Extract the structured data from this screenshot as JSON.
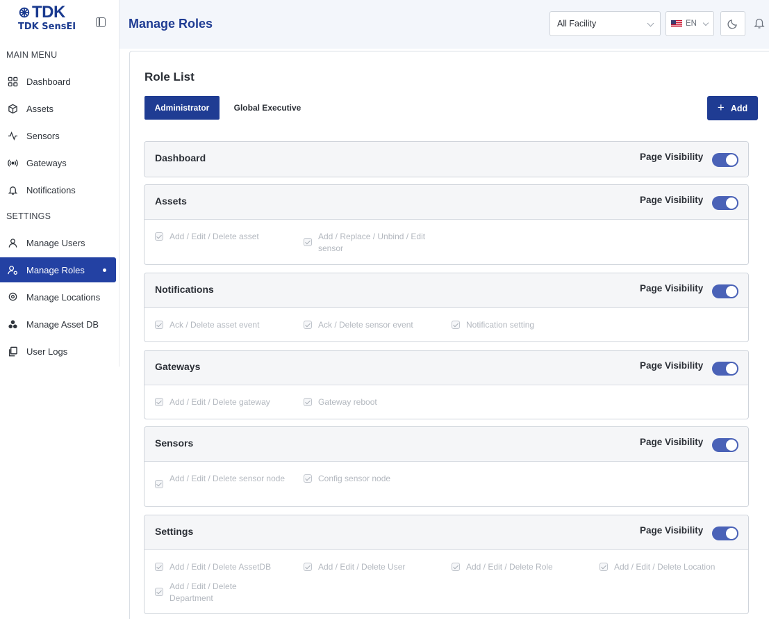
{
  "brand": {
    "logo_text": "TDK",
    "product_name": "TDK SensEI"
  },
  "sidebar": {
    "main_menu_label": "MAIN MENU",
    "settings_label": "SETTINGS",
    "main_items": [
      {
        "label": "Dashboard",
        "icon": "dashboard-grid-icon"
      },
      {
        "label": "Assets",
        "icon": "cube-icon"
      },
      {
        "label": "Sensors",
        "icon": "pulse-icon"
      },
      {
        "label": "Gateways",
        "icon": "broadcast-icon"
      },
      {
        "label": "Notifications",
        "icon": "bell-icon"
      }
    ],
    "settings_items": [
      {
        "label": "Manage Users",
        "icon": "user-icon"
      },
      {
        "label": "Manage Roles",
        "icon": "user-key-icon",
        "active": true
      },
      {
        "label": "Manage Locations",
        "icon": "location-pin-icon"
      },
      {
        "label": "Manage Asset DB",
        "icon": "asset-db-icon"
      },
      {
        "label": "User Logs",
        "icon": "copy-doc-icon"
      }
    ]
  },
  "header": {
    "title": "Manage Roles",
    "facility_selected": "All Facility",
    "language": "EN"
  },
  "role_list": {
    "title": "Role List",
    "tabs": [
      "Administrator",
      "Global Executive"
    ],
    "active_tab": "Administrator",
    "add_label": "Add"
  },
  "permissions": {
    "visibility_label": "Page Visibility",
    "sections": [
      {
        "name": "Dashboard",
        "visible": true,
        "items": []
      },
      {
        "name": "Assets",
        "visible": true,
        "items": [
          "Add / Edit / Delete asset",
          "Add / Replace / Unbind / Edit sensor"
        ]
      },
      {
        "name": "Notifications",
        "visible": true,
        "items": [
          "Ack / Delete asset event",
          "Ack / Delete sensor event",
          "Notification setting"
        ]
      },
      {
        "name": "Gateways",
        "visible": true,
        "items": [
          "Add / Edit / Delete gateway",
          "Gateway reboot"
        ]
      },
      {
        "name": "Sensors",
        "visible": true,
        "items": [
          "Add / Edit / Delete sensor node",
          "Config sensor node"
        ]
      },
      {
        "name": "Settings",
        "visible": true,
        "items": [
          "Add / Edit / Delete AssetDB",
          "Add / Edit / Delete User",
          "Add / Edit / Delete Role",
          "Add / Edit / Delete Location",
          "Add / Edit / Delete Department"
        ]
      }
    ]
  },
  "colors": {
    "primary": "#1f3c93",
    "toggle_on": "#4a62b7",
    "header_bg": "#f3f6fb"
  }
}
